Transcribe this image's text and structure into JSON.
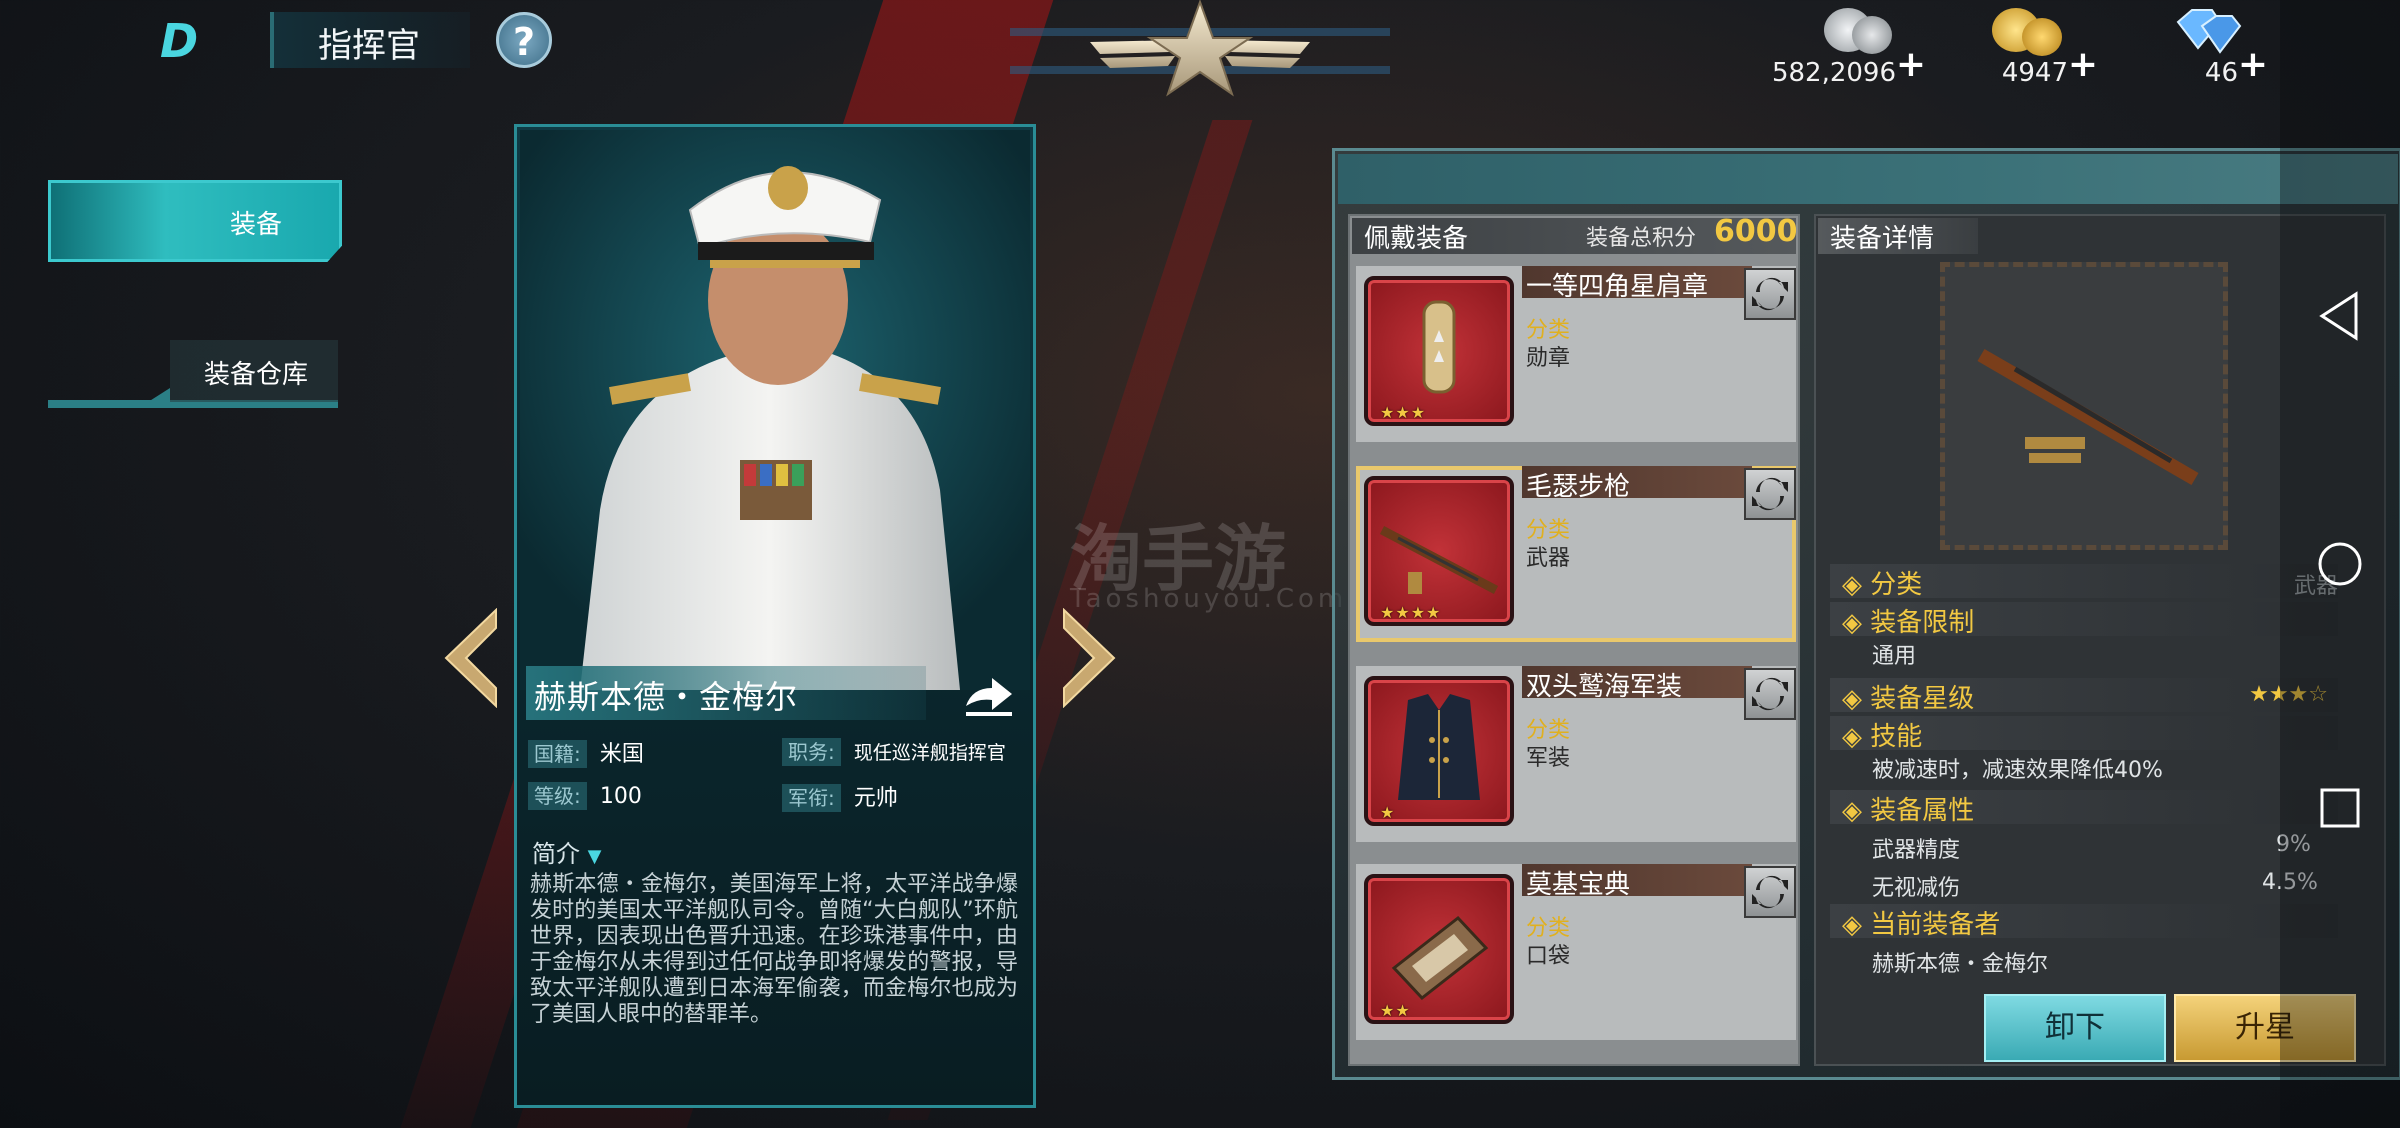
{
  "header": {
    "logo_text": "D",
    "title": "指挥官",
    "help_icon": "?"
  },
  "resources": [
    {
      "name": "silver",
      "value": "582,2096",
      "plus": "+",
      "color": "#c0c4c8"
    },
    {
      "name": "gold",
      "value": "4947",
      "plus": "+",
      "color": "#e6b43a"
    },
    {
      "name": "diamond",
      "value": "46",
      "plus": "+",
      "color": "#5aa8f0"
    }
  ],
  "left_tabs": [
    {
      "label": "装备",
      "active": true
    },
    {
      "label": "装备仓库",
      "active": false
    }
  ],
  "commander": {
    "name": "赫斯本德・金梅尔",
    "fields": [
      {
        "label": "国籍:",
        "value": "米国"
      },
      {
        "label": "职务:",
        "value": "现任巡洋舰指挥官"
      },
      {
        "label": "等级:",
        "value": "100"
      },
      {
        "label": "军衔:",
        "value": "元帅"
      }
    ],
    "intro_title": "简介",
    "intro_text": "赫斯本德・金梅尔，美国海军上将，太平洋战争爆发时的美国太平洋舰队司令。曾随“大白舰队”环航世界，因表现出色晋升迅速。在珍珠港事件中，由于金梅尔从未得到过任何战争即将爆发的警报，导致太平洋舰队遭到日本海军偷袭，而金梅尔也成为了美国人眼中的替罪羊。"
  },
  "watermark": {
    "title": "淘手游",
    "sub": "Taoshouyou.Com"
  },
  "equipped": {
    "title": "佩戴装备",
    "score_label": "装备总积分",
    "score": "6000",
    "items": [
      {
        "name": "一等四角星肩章",
        "cat_label": "分类",
        "cat": "勋章",
        "stars": "★★★",
        "selected": false
      },
      {
        "name": "毛瑟步枪",
        "cat_label": "分类",
        "cat": "武器",
        "stars": "★★★★",
        "selected": true
      },
      {
        "name": "双头鹫海军装",
        "cat_label": "分类",
        "cat": "军装",
        "stars": "★",
        "selected": false
      },
      {
        "name": "莫基宝典",
        "cat_label": "分类",
        "cat": "口袋",
        "stars": "★★",
        "selected": false
      }
    ]
  },
  "detail": {
    "title": "装备详情",
    "rows": [
      {
        "label": "分类",
        "value": "武器"
      },
      {
        "label": "装备限制",
        "value": "通用"
      },
      {
        "label": "装备星级",
        "value": "★★★☆"
      },
      {
        "label": "技能",
        "value": "被减速时，减速效果降低40%"
      },
      {
        "label": "装备属性",
        "value": ""
      },
      {
        "label": "武器精度",
        "value": "9%"
      },
      {
        "label": "无视减伤",
        "value": "4.5%"
      },
      {
        "label": "当前装备者",
        "value": "赫斯本德・金梅尔"
      }
    ],
    "btn_unload": "卸下",
    "btn_upstar": "升星"
  }
}
